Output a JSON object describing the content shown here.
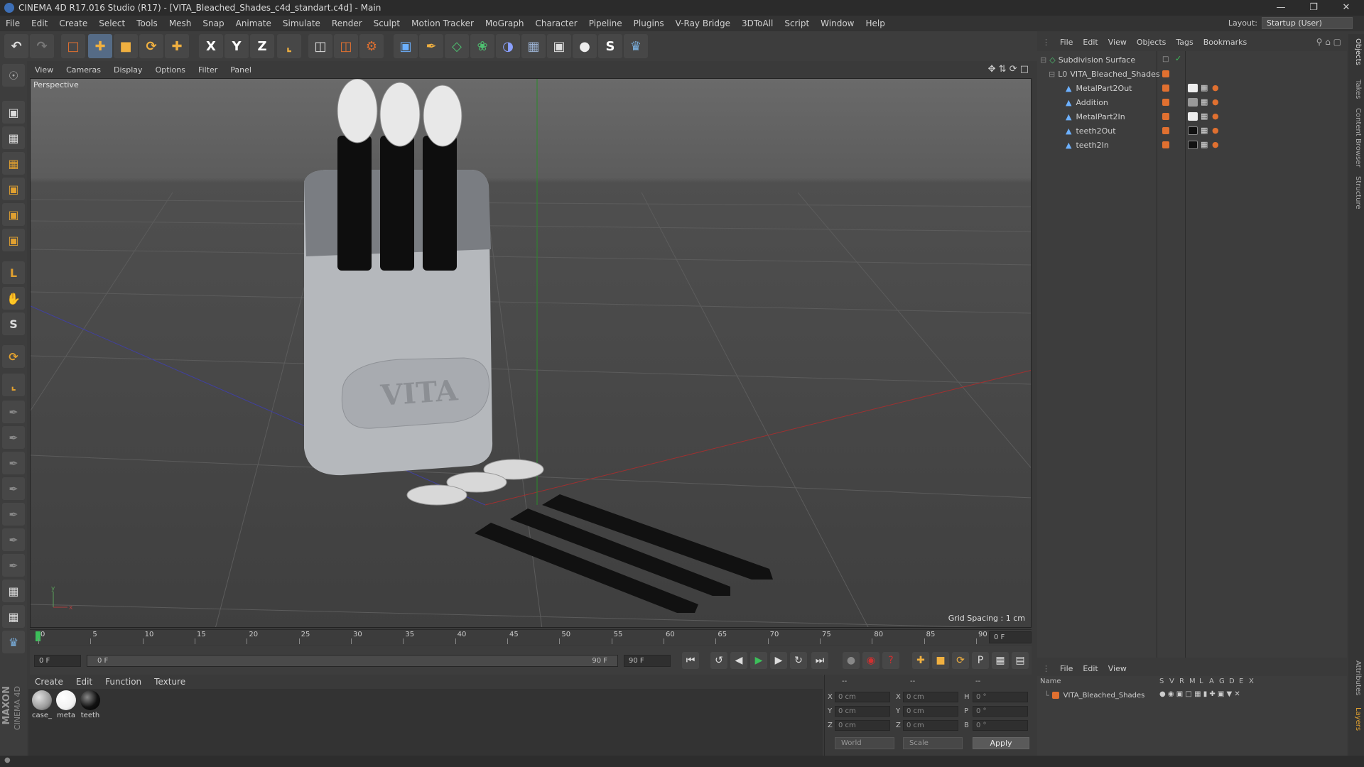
{
  "window": {
    "title": "CINEMA 4D R17.016 Studio (R17) - [VITA_Bleached_Shades_c4d_standart.c4d] - Main"
  },
  "menu": [
    "File",
    "Edit",
    "Create",
    "Select",
    "Tools",
    "Mesh",
    "Snap",
    "Animate",
    "Simulate",
    "Render",
    "Sculpt",
    "Motion Tracker",
    "MoGraph",
    "Character",
    "Pipeline",
    "Plugins",
    "V-Ray Bridge",
    "3DToAll",
    "Script",
    "Window",
    "Help"
  ],
  "layout": {
    "label": "Layout:",
    "value": "Startup (User)"
  },
  "toolbar": {
    "x": "X",
    "y": "Y",
    "z": "Z"
  },
  "viewport": {
    "menu": [
      "View",
      "Cameras",
      "Display",
      "Options",
      "Filter",
      "Panel"
    ],
    "label": "Perspective",
    "grid_spacing": "Grid Spacing : 1 cm",
    "case_text": "VITA",
    "axis_y": "y",
    "axis_x": "x"
  },
  "timeline": {
    "ticks": [
      "0",
      "5",
      "10",
      "15",
      "20",
      "25",
      "30",
      "35",
      "40",
      "45",
      "50",
      "55",
      "60",
      "65",
      "70",
      "75",
      "80",
      "85",
      "90"
    ],
    "frame_end": "0 F"
  },
  "timectrl": {
    "start": "0 F",
    "range_start": "0 F",
    "range_end": "90 F",
    "end": "90 F"
  },
  "materials": {
    "menu": [
      "Create",
      "Edit",
      "Function",
      "Texture"
    ],
    "items": [
      {
        "name": "case_",
        "color": "#9a9a9a"
      },
      {
        "name": "meta",
        "color": "#f2f2f2"
      },
      {
        "name": "teeth",
        "color": "#111111"
      }
    ]
  },
  "coords": {
    "header": [
      "--",
      "--",
      "--"
    ],
    "rows": [
      {
        "a": "X",
        "av": "0 cm",
        "b": "X",
        "bv": "0 cm",
        "c": "H",
        "cv": "0 °"
      },
      {
        "a": "Y",
        "av": "0 cm",
        "b": "Y",
        "bv": "0 cm",
        "c": "P",
        "cv": "0 °"
      },
      {
        "a": "Z",
        "av": "0 cm",
        "b": "Z",
        "bv": "0 cm",
        "c": "B",
        "cv": "0 °"
      }
    ],
    "mode": "World",
    "scale": "Scale",
    "apply": "Apply"
  },
  "objects": {
    "menu": [
      "File",
      "Edit",
      "View",
      "Objects",
      "Tags",
      "Bookmarks"
    ],
    "items": [
      {
        "name": "Subdivision Surface",
        "indent": 0
      },
      {
        "name": "VITA_Bleached_Shades",
        "indent": 1
      },
      {
        "name": "MetalPart2Out",
        "indent": 2
      },
      {
        "name": "Addition",
        "indent": 2
      },
      {
        "name": "MetalPart2In",
        "indent": 2
      },
      {
        "name": "teeth2Out",
        "indent": 2
      },
      {
        "name": "teeth2In",
        "indent": 2
      }
    ]
  },
  "layers": {
    "menu": [
      "File",
      "Edit",
      "View"
    ],
    "cols": [
      "Name",
      "S",
      "V",
      "R",
      "M",
      "L",
      "A",
      "G",
      "D",
      "E",
      "X"
    ],
    "items": [
      {
        "name": "VITA_Bleached_Shades"
      }
    ]
  },
  "sidetabs": [
    "Objects",
    "Takes",
    "Content Browser",
    "Structure",
    "Attributes",
    "Layers"
  ],
  "brand": {
    "maxon": "MAXON",
    "c4d": "CINEMA 4D"
  }
}
